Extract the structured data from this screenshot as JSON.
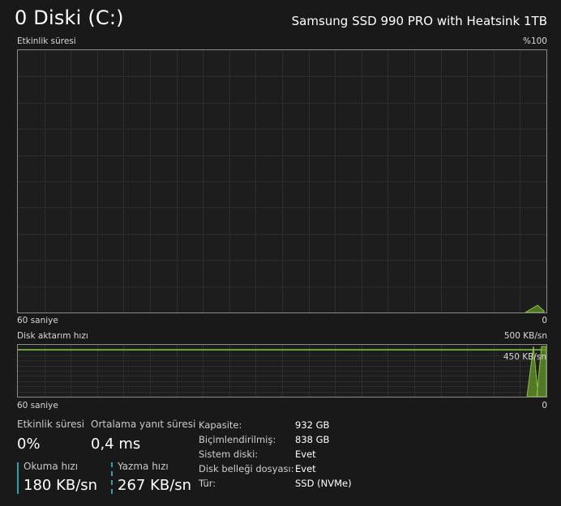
{
  "header": {
    "title": "0 Diski (C:)",
    "model": "Samsung SSD 990 PRO with Heatsink 1TB"
  },
  "activity_graph": {
    "label": "Etkinlik süresi",
    "max_label": "%100",
    "time_label": "60 saniye",
    "min_label": "0",
    "line_color": "#8cc63f"
  },
  "transfer_graph": {
    "label": "Disk aktarım hızı",
    "max_label": "500 KB/sn",
    "ref_label": "450 KB/sn",
    "time_label": "60 saniye",
    "min_label": "0",
    "line_color": "#8cc63f"
  },
  "stats": {
    "activity_label": "Etkinlik süresi",
    "activity_value": "0%",
    "response_label": "Ortalama yanıt süresi",
    "response_value": "0,4 ms",
    "read_label": "Okuma hızı",
    "read_value": "180 KB/sn",
    "write_label": "Yazma hızı",
    "write_value": "267 KB/sn",
    "accent_color": "#2aa3a3"
  },
  "properties": [
    {
      "label": "Kapasite:",
      "value": "932 GB"
    },
    {
      "label": "Biçimlendirilmiş:",
      "value": "838 GB"
    },
    {
      "label": "Sistem diski:",
      "value": "Evet"
    },
    {
      "label": "Disk belleği dosyası:",
      "value": "Evet"
    },
    {
      "label": "Tür:",
      "value": "SSD (NVMe)"
    }
  ]
}
